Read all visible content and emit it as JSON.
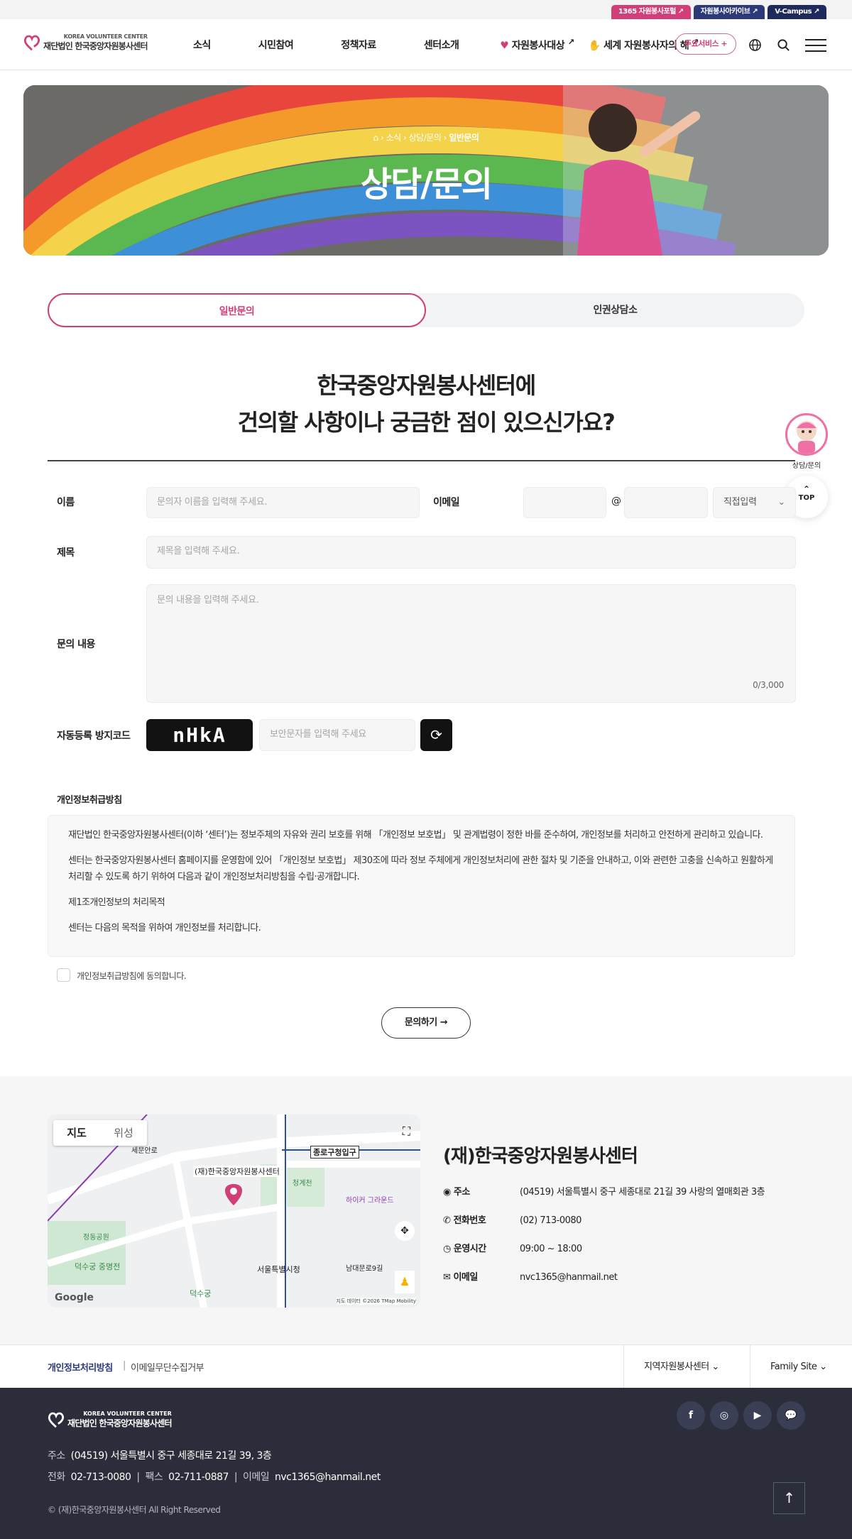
{
  "topbar": {
    "links": [
      "1365 자원봉사포털",
      "자원봉사아카이브",
      "V-Campus"
    ]
  },
  "logo": {
    "en": "KOREA VOLUNTEER CENTER",
    "ko": "재단법인 한국중앙자원봉사센터"
  },
  "nav": {
    "items": [
      "소식",
      "시민참여",
      "정책자료",
      "센터소개"
    ],
    "special1": "자원봉사대상",
    "special2": "세계 자원봉사자의 해",
    "main_service": "주요서비스 +"
  },
  "hero": {
    "crumb_current": "일반문의",
    "crumb_1": "소식",
    "crumb_2": "상담/문의",
    "title": "상담/문의"
  },
  "tabs": {
    "t1": "일반문의",
    "t2": "인권상담소"
  },
  "headline": {
    "line1": "한국중앙자원봉사센터에",
    "line2": "건의할 사항이나 궁금한 점이 있으신가요?"
  },
  "form": {
    "name_label": "이름",
    "name_ph": "문의자 이름을 입력해 주세요.",
    "email_label": "이메일",
    "at": "@",
    "domain_select": "직접입력",
    "subject_label": "제목",
    "subject_ph": "제목을 입력해 주세요.",
    "content_label": "문의 내용",
    "content_ph": "문의 내용을 입력해 주세요.",
    "counter": "0/3,000",
    "captcha_label": "자동등록 방지코드",
    "captcha_code": "nHkA",
    "captcha_ph": "보안문자를 입력해 주세요"
  },
  "privacy": {
    "title": "개인정보취급방침",
    "p1": "재단법인 한국중앙자원봉사센터(이하 ‘센터’)는 정보주체의 자유와 권리 보호를 위해 「개인정보 보호법」 및 관계법령이 정한 바를 준수하여, 개인정보를 처리하고 안전하게 관리하고 있습니다.",
    "p2": "센터는 한국중앙자원봉사센터 홈페이지를 운영함에 있어 「개인정보 보호법」 제30조에 따라 정보 주체에게 개인정보처리에 관한 절차 및 기준을 안내하고, 이와 관련한 고충을 신속하고 원활하게 처리할 수 있도록 하기 위하여 다음과 같이 개인정보처리방침을 수립·공개합니다.",
    "p3": "제1조개인정보의 처리목적",
    "p4": "센터는 다음의 목적을 위하여 개인정보를 처리합니다.",
    "agree": "개인정보취급방침에 동의합니다."
  },
  "submit": "문의하기",
  "floating": {
    "label": "상담/문의",
    "top": "TOP"
  },
  "map": {
    "tab_map": "지도",
    "tab_sat": "위성",
    "google": "Google",
    "labels": [
      "세문안로",
      "종로구청입구",
      "(재)한국중앙자원봉사센터",
      "청계천",
      "하이커 그라운드",
      "정동공원",
      "덕수궁 중명전",
      "서울특별시청",
      "남대문로9길",
      "덕수궁"
    ],
    "credit": "지도 데이터 ©2026 TMap Mobility"
  },
  "center": {
    "name": "(재)한국중앙자원봉사센터",
    "addr_label": "주소",
    "addr": "(04519) 서울특별시 중구 세종대로 21길 39 사랑의 열매회관 3층",
    "tel_label": "전화번호",
    "tel": "(02) 713-0080",
    "hours_label": "운영시간",
    "hours": "09:00 ~ 18:00",
    "mail_label": "이메일",
    "mail": "nvc1365@hanmail.net"
  },
  "footer": {
    "privacy": "개인정보처리방침",
    "noemail": "이메일무단수집거부",
    "regional": "지역자원봉사센터",
    "family": "Family Site",
    "addr_k": "주소",
    "addr": "(04519) 서울특별시 중구 세종대로 21길 39, 3층",
    "tel_k": "전화",
    "tel": "02-713-0080",
    "fax_k": "팩스",
    "fax": "02-711-0887",
    "mail_k": "이메일",
    "mail": "nvc1365@hanmail.net",
    "copy": "© (재)한국중앙자원봉사센터 All Right Reserved"
  },
  "colors": {
    "accent": "#d23f78",
    "navy": "#222b5c",
    "footer": "#2b2d3a"
  }
}
